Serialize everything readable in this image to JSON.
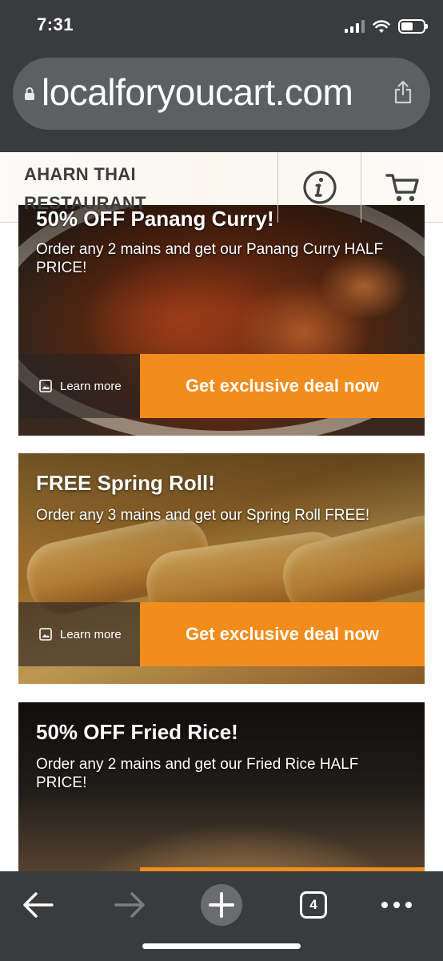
{
  "status_bar": {
    "time": "7:31"
  },
  "browser": {
    "url": "localforyoucart.com",
    "open_tabs": "4"
  },
  "site_header": {
    "name_line1": "AHARN THAI",
    "name_line2": "RESTAURANT",
    "info_icon": "info-icon",
    "cart_icon": "cart-icon"
  },
  "deals": [
    {
      "title": "50% OFF Panang Curry!",
      "description": "Order any 2 mains and get our Panang Curry HALF PRICE!",
      "learn_more": "Learn more",
      "button": "Get exclusive deal now"
    },
    {
      "title": "FREE Spring Roll!",
      "description": "Order any 3 mains and get our Spring Roll FREE!",
      "learn_more": "Learn more",
      "button": "Get exclusive deal now"
    },
    {
      "title": "50% OFF Fried Rice!",
      "description": "Order any 2 mains and get our Fried Rice HALF PRICE!"
    }
  ],
  "colors": {
    "accent_orange": "#f28c1c",
    "chrome_dark": "#3a3b3d",
    "url_pill": "#5d6063"
  }
}
